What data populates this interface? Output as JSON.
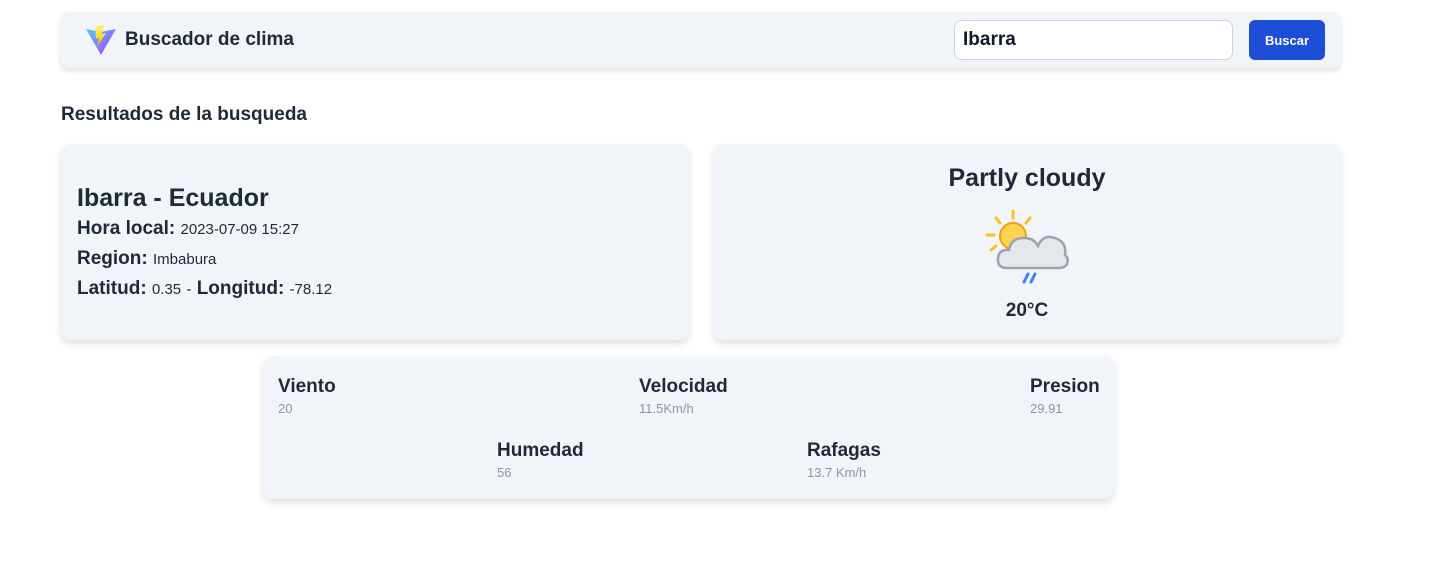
{
  "header": {
    "logo_icon": "vite-lightning-logo-icon",
    "title": "Buscador de clima",
    "search": {
      "value": "Ibarra",
      "placeholder": ""
    },
    "search_button_label": "Buscar",
    "accent_color": "#1d4ed8"
  },
  "results": {
    "heading": "Resultados de la busqueda",
    "location": {
      "name": "Ibarra - Ecuador",
      "local_time_label": "Hora local:",
      "local_time": "2023-07-09 15:27",
      "region_label": "Region:",
      "region": "Imbabura",
      "lat_label": "Latitud:",
      "lat": "0.35",
      "separator": "-",
      "lon_label": "Longitud:",
      "lon": "-78.12"
    },
    "condition": {
      "text": "Partly cloudy",
      "icon": "partly-cloudy-rain-icon",
      "temperature": "20°C"
    },
    "details": {
      "viento": {
        "label": "Viento",
        "value": "20"
      },
      "velocidad": {
        "label": "Velocidad",
        "value": "11.5Km/h"
      },
      "presion": {
        "label": "Presion",
        "value": "29.91"
      },
      "humedad": {
        "label": "Humedad",
        "value": "56"
      },
      "rafagas": {
        "label": "Rafagas",
        "value": "13.7 Km/h"
      }
    }
  }
}
